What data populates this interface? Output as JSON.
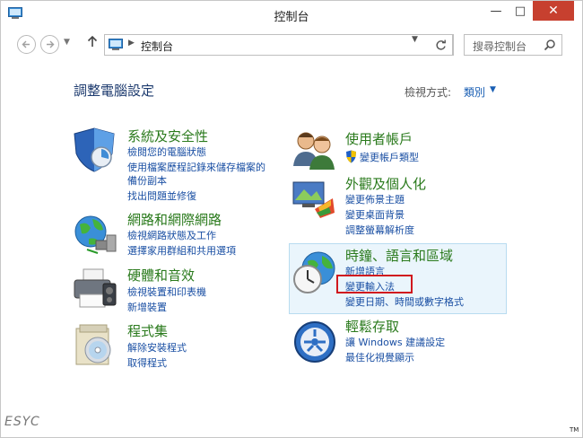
{
  "window": {
    "title": "控制台",
    "minimize_glyph": "—",
    "maximize_glyph": "□",
    "close_glyph": "✕"
  },
  "address_bar": {
    "path": "控制台",
    "search_placeholder": "搜尋控制台"
  },
  "page": {
    "title": "調整電腦設定",
    "view_by_label": "檢視方式:",
    "view_by_value": "類別"
  },
  "categories": [
    {
      "title": "系統及安全性",
      "icon": "shield-icon",
      "links": [
        "檢閱您的電腦狀態",
        "使用檔案歷程記錄來儲存檔案的",
        "備份副本",
        "找出問題並修復"
      ]
    },
    {
      "title": "網路和網際網路",
      "icon": "network-globe-icon",
      "links": [
        "檢視網路狀態及工作",
        "選擇家用群組和共用選項"
      ]
    },
    {
      "title": "硬體和音效",
      "icon": "printer-icon",
      "links": [
        "檢視裝置和印表機",
        "新增裝置"
      ]
    },
    {
      "title": "程式集",
      "icon": "programs-disc-icon",
      "links": [
        "解除安裝程式",
        "取得程式"
      ]
    },
    {
      "title": "使用者帳戶",
      "icon": "users-icon",
      "links": [
        "變更帳戶類型"
      ]
    },
    {
      "title": "外觀及個人化",
      "icon": "display-paint-icon",
      "links": [
        "變更佈景主題",
        "變更桌面背景",
        "調整螢幕解析度"
      ]
    },
    {
      "title": "時鐘、語言和區域",
      "icon": "clock-globe-icon",
      "links": [
        "新增語言",
        "變更輸入法",
        "變更日期、時間或數字格式"
      ]
    },
    {
      "title": "輕鬆存取",
      "icon": "ease-of-access-icon",
      "links": [
        "讓 Windows 建議設定",
        "最佳化視覺顯示"
      ]
    }
  ],
  "watermark": "ESYC",
  "trademark": "TM"
}
